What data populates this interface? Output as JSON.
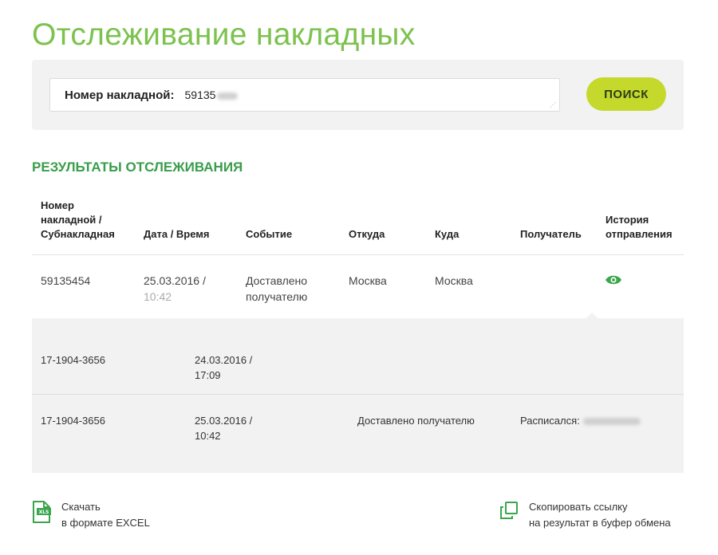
{
  "page": {
    "title": "Отслеживание накладных"
  },
  "search": {
    "label": "Номер накладной:",
    "value": "59135",
    "button_label": "ПОИСК"
  },
  "results": {
    "title": "РЕЗУЛЬТАТЫ ОТСЛЕЖИВАНИЯ",
    "columns": [
      "Номер\nнакладной /\nСубнакладная",
      "Дата / Время",
      "Событие",
      "Откуда",
      "Куда",
      "Получатель",
      "История\nотправления"
    ],
    "row": {
      "number": "59135454",
      "date": "25.03.2016 /",
      "time": "10:42",
      "event": "Доставлено\nполучателю",
      "from": "Москва",
      "to": "Москва",
      "recipient": "",
      "history_icon": "eye-icon"
    },
    "sub_rows": [
      {
        "number": "17-1904-3656",
        "date": "24.03.2016 /",
        "time": "17:09",
        "event": "",
        "signed": ""
      },
      {
        "number": "17-1904-3656",
        "date": "25.03.2016 /",
        "time": "10:42",
        "event": "Доставлено получателю",
        "signed": "Расписался:"
      }
    ]
  },
  "footer": {
    "excel": {
      "label": "Скачать\nв формате EXCEL",
      "icon": "excel-file-icon"
    },
    "copy": {
      "label": "Скопировать ссылку\nна результат в буфер обмена",
      "icon": "copy-link-icon"
    }
  },
  "colors": {
    "accent_green": "#7cc24e",
    "section_green": "#3a9d4c",
    "button_lime": "#c4d92c"
  }
}
